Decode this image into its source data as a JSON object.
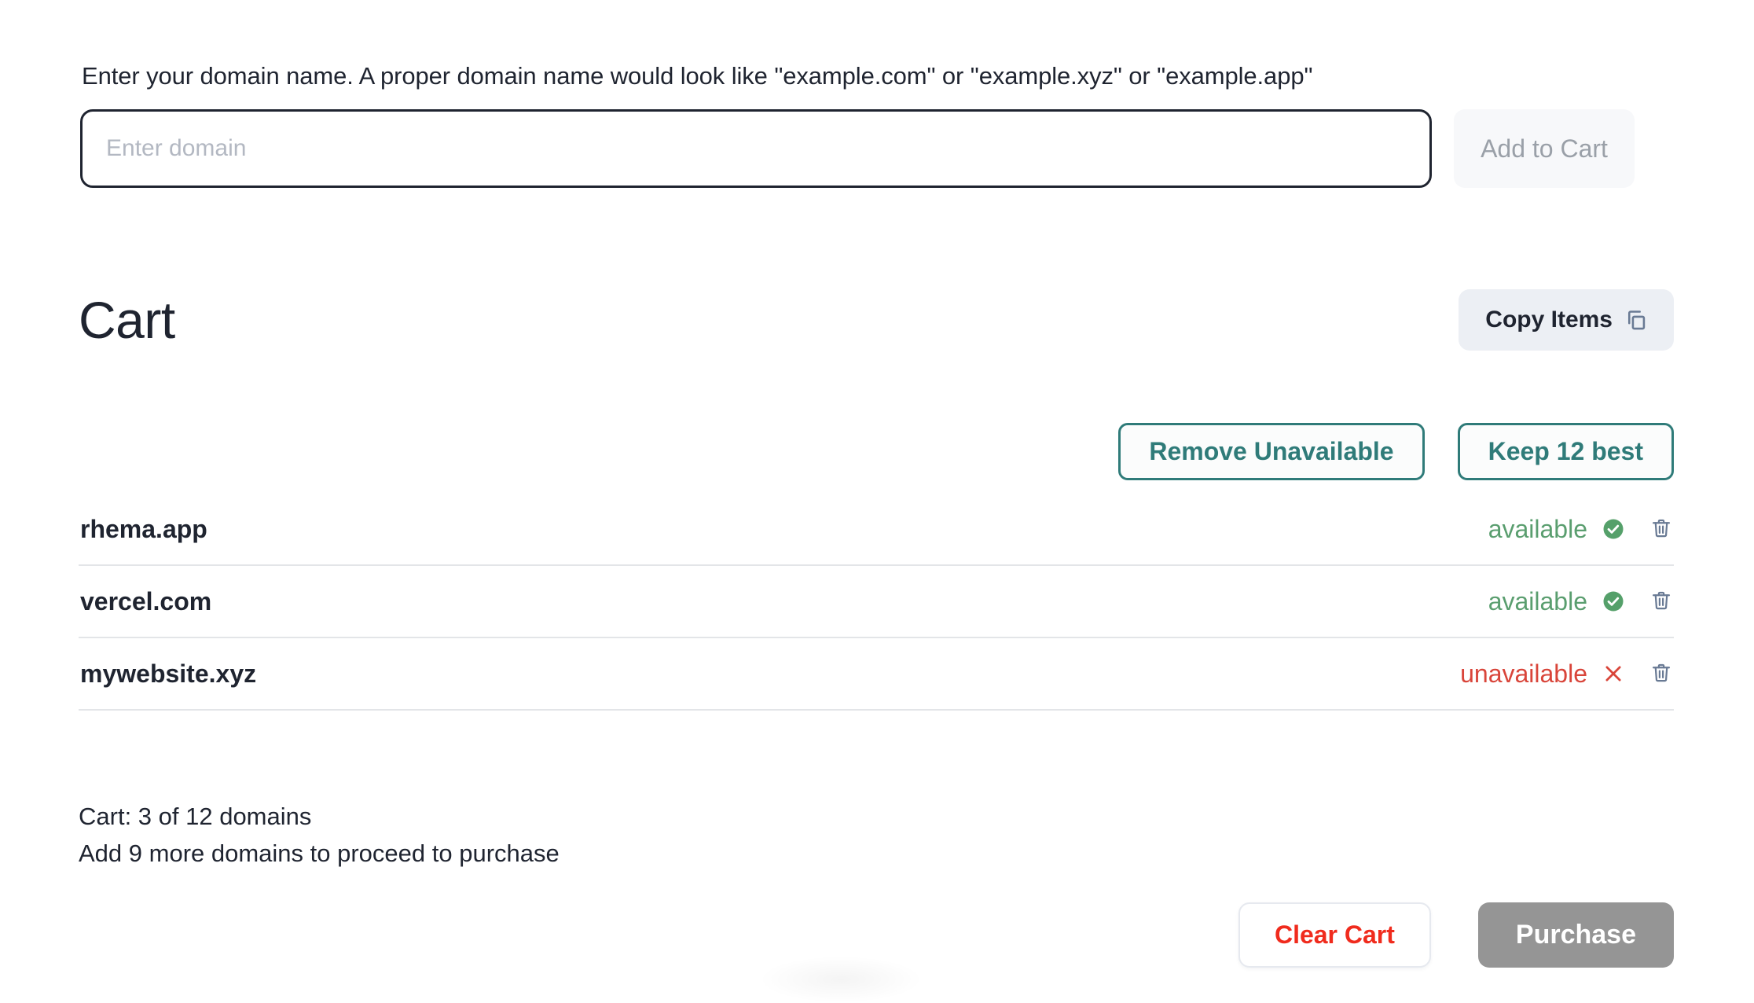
{
  "search": {
    "hint": "Enter your domain name. A proper domain name would look like \"example.com\" or \"example.xyz\" or \"example.app\"",
    "input_placeholder": "Enter domain",
    "input_value": "",
    "add_button_label": "Add to Cart"
  },
  "cart": {
    "title": "Cart",
    "copy_items_label": "Copy Items",
    "copy_icon": "copy-icon",
    "filters": {
      "remove_unavailable_label": "Remove Unavailable",
      "keep_best_label": "Keep 12 best"
    },
    "items": [
      {
        "domain": "rhema.app",
        "status": "available",
        "status_type": "available",
        "status_icon": "check-circle-icon",
        "delete_icon": "trash-icon"
      },
      {
        "domain": "vercel.com",
        "status": "available",
        "status_type": "available",
        "status_icon": "check-circle-icon",
        "delete_icon": "trash-icon"
      },
      {
        "domain": "mywebsite.xyz",
        "status": "unavailable",
        "status_type": "unavailable",
        "status_icon": "x-icon",
        "delete_icon": "trash-icon"
      }
    ],
    "summary_line_1": "Cart: 3 of 12 domains",
    "summary_line_2": "Add 9 more domains to proceed to purchase",
    "clear_cart_label": "Clear Cart",
    "purchase_label": "Purchase"
  },
  "colors": {
    "accent_teal": "#2f7b79",
    "available_green": "#5a9e6f",
    "unavailable_red": "#d9453a",
    "clear_red": "#f02b1d",
    "disabled_grey": "#959595",
    "icon_slate": "#697a94",
    "text_dark": "#1f2430"
  }
}
